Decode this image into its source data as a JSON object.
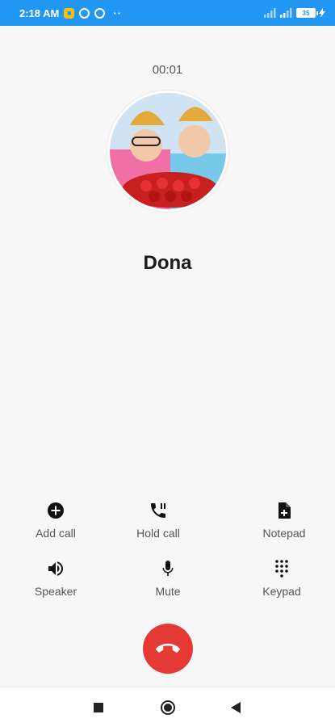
{
  "status_bar": {
    "time": "2:18 AM",
    "battery": "35",
    "more_indicator": "··"
  },
  "call": {
    "timer": "00:01",
    "contact_name": "Dona"
  },
  "actions": [
    {
      "label": "Add call",
      "icon": "add-circle-icon"
    },
    {
      "label": "Hold call",
      "icon": "phone-pause-icon"
    },
    {
      "label": "Notepad",
      "icon": "note-add-icon"
    },
    {
      "label": "Speaker",
      "icon": "speaker-icon"
    },
    {
      "label": "Mute",
      "icon": "microphone-icon"
    },
    {
      "label": "Keypad",
      "icon": "dialpad-icon"
    }
  ],
  "colors": {
    "status_bar": "#2196f3",
    "end_call": "#e53935",
    "background": "#f7f7f7"
  },
  "nav": {
    "icons": [
      "recents-square-icon",
      "home-circle-icon",
      "back-triangle-icon"
    ]
  }
}
